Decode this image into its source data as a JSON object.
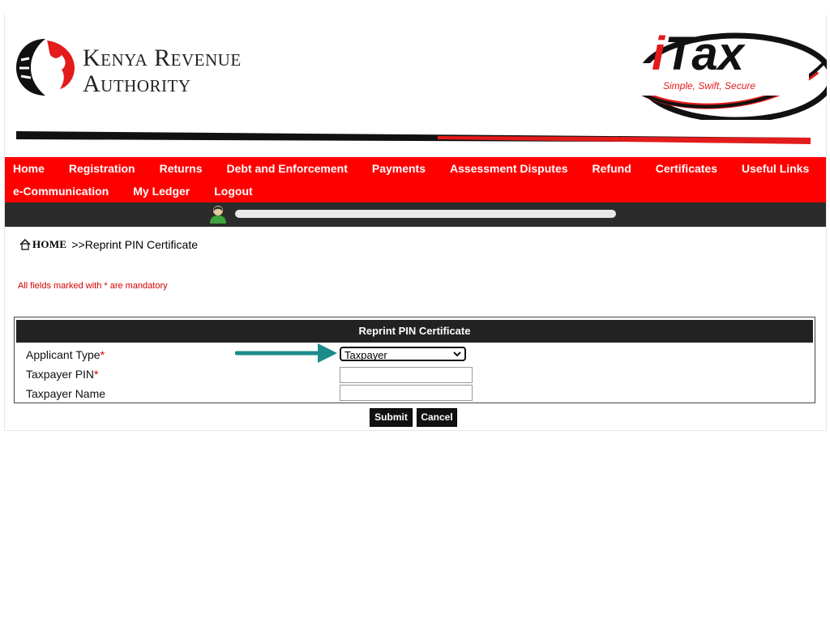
{
  "header": {
    "org_line1": "Kenya Revenue",
    "org_line2": "Authority",
    "itax_brand": "iTax",
    "itax_tagline": "Simple, Swift, Secure"
  },
  "nav": {
    "row1": [
      "Home",
      "Registration",
      "Returns",
      "Debt and Enforcement",
      "Payments",
      "Assessment Disputes",
      "Refund",
      "Certificates",
      "Useful Links"
    ],
    "row2": [
      "e-Communication",
      "My Ledger",
      "Logout"
    ]
  },
  "breadcrumb": {
    "home": "HOME",
    "current": ">>Reprint PIN Certificate"
  },
  "notice": "All fields marked with * are mandatory",
  "form": {
    "title": "Reprint PIN Certificate",
    "applicant_type_label": "Applicant Type",
    "applicant_type_value": "Taxpayer",
    "taxpayer_pin_label": "Taxpayer PIN",
    "taxpayer_name_label": "Taxpayer Name",
    "required_mark": "*"
  },
  "buttons": {
    "submit": "Submit",
    "cancel": "Cancel"
  },
  "colors": {
    "nav_bg": "#ff0000",
    "accent_arrow": "#1a8c8c",
    "required": "#d40000"
  }
}
